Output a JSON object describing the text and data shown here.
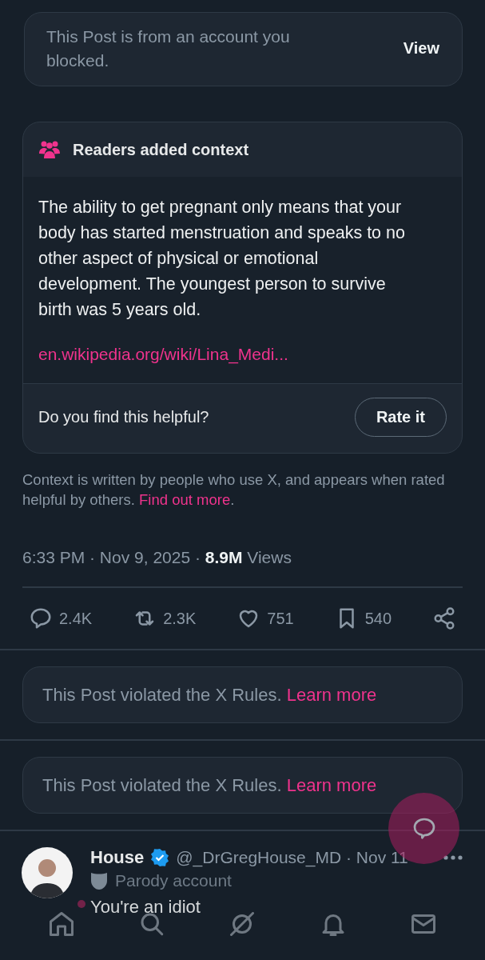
{
  "blocked_notice": {
    "text": "This Post is from an account you blocked.",
    "button": "View"
  },
  "community_note": {
    "title": "Readers added context",
    "body": "The ability to get pregnant only means that your body has started menstruation and speaks to no other aspect of physical or emotional development. The youngest person to survive birth was 5 years old.",
    "link": "en.wikipedia.org/wiki/Lina_Medi...",
    "question": "Do you find this helpful?",
    "button": "Rate it"
  },
  "note_disclaimer": {
    "text": "Context is written by people who use X, and appears when rated helpful by others. ",
    "link": "Find out more",
    "end": "."
  },
  "post_meta": "6:33 PM · Nov 9, 2025 · **8.9M** Views",
  "actions": [
    {
      "kind": "reply",
      "count": "2.4K"
    },
    {
      "kind": "repost",
      "count": "2.3K"
    },
    {
      "kind": "like",
      "count": "751"
    },
    {
      "kind": "bookmark",
      "count": "540"
    },
    {
      "kind": "share"
    }
  ],
  "violations": [
    {
      "text": "This Post violated the X Rules.",
      "link": "Learn more"
    },
    {
      "text": "This Post violated the X Rules.",
      "link": "Learn more"
    }
  ],
  "reply": {
    "name": "House",
    "verified": true,
    "handle": "@_DrGregHouse_MD · Nov 11",
    "label": "Parody account",
    "text": "You're an idiot"
  },
  "nav": [
    {
      "kind": "home",
      "dot": true
    },
    {
      "kind": "search",
      "dot": false
    },
    {
      "kind": "grok",
      "dot": false
    },
    {
      "kind": "bell",
      "dot": false
    },
    {
      "kind": "mail",
      "dot": false
    }
  ]
}
